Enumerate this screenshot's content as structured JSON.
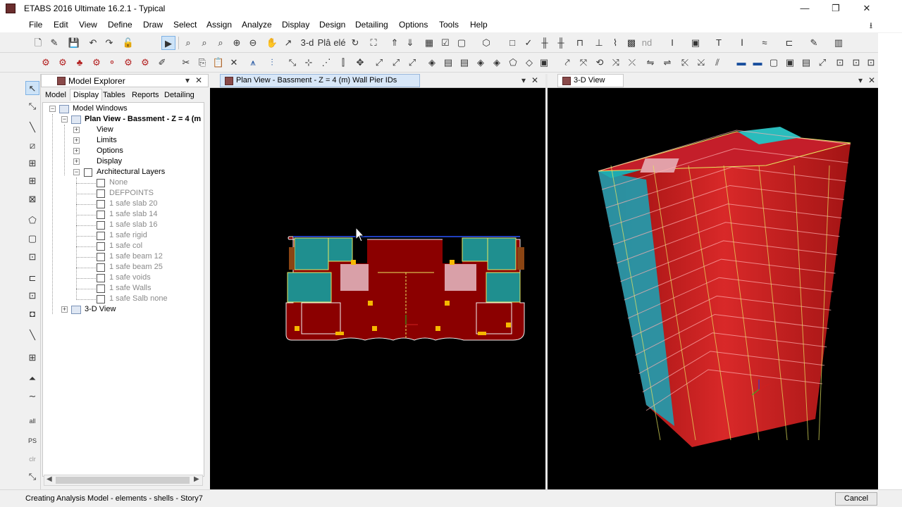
{
  "window": {
    "title": "ETABS 2016 Ultimate 16.2.1 - Typical",
    "minimize_icon": "—",
    "restore_icon": "❐",
    "close_icon": "✕"
  },
  "menu": {
    "file": "File",
    "edit": "Edit",
    "view": "View",
    "define": "Define",
    "draw": "Draw",
    "select": "Select",
    "assign": "Assign",
    "analyze": "Analyze",
    "display": "Display",
    "design": "Design",
    "detailing": "Detailing",
    "options": "Options",
    "tools": "Tools",
    "help": "Help"
  },
  "toolbar": {
    "three_d_label": "3-d",
    "plan_label": "Plâ",
    "elev_label": "elé",
    "nd_label": "nd"
  },
  "explorer": {
    "title": "Model Explorer",
    "pin": "▾",
    "close": "✕",
    "tabs": {
      "model": "Model",
      "display": "Display",
      "tables": "Tables",
      "reports": "Reports",
      "detailing": "Detailing"
    },
    "tree": {
      "root": "Model Windows",
      "plan_view": "Plan View - Bassment - Z = 4 (m",
      "view": "View",
      "limits": "Limits",
      "options": "Options",
      "display": "Display",
      "arch_layers": "Architectural Layers",
      "layers": [
        "None",
        "DEFPOINTS",
        "1 safe slab 20",
        "1 safe slab 14",
        "1 safe slab 16",
        "1 safe rigid",
        "1 safe col",
        "1 safe beam 12",
        "1 safe beam 25",
        "1 safe voids",
        "1 safe Walls",
        "1 safe Salb none"
      ],
      "three_d_view": "3-D View"
    }
  },
  "plan_view": {
    "title": "Plan View - Bassment - Z = 4 (m)  Wall Pier IDs",
    "pin": "▾",
    "close": "✕"
  },
  "view_3d": {
    "title": "3-D View",
    "pin": "▾",
    "close": "✕"
  },
  "status": {
    "text": "Creating Analysis Model - elements - shells - Story7",
    "cancel": "Cancel"
  },
  "colors": {
    "slab": "#8b0000",
    "wall": "#1f8f8f",
    "opening": "#d9a0a8",
    "column": "#f5b800",
    "beam": "#e8e860",
    "red3d": "#e81e1e"
  }
}
